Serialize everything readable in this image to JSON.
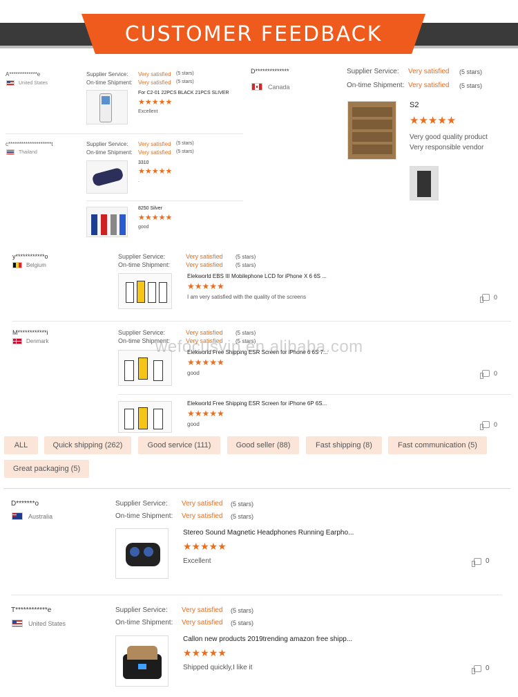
{
  "banner": {
    "title": "CUSTOMER FEEDBACK"
  },
  "labels": {
    "supplier_service": "Supplier Service:",
    "on_time_shipment": "On-time Shipment:",
    "very_satisfied": "Very satisfied",
    "five_stars": "(5 stars)",
    "star_glyph": "★★★★★"
  },
  "collage": {
    "left_reviews": [
      {
        "user": "A*************e",
        "country": "United States",
        "products": [
          {
            "title": "For C2-01 22PCS BLACK 21PCS SLIVER",
            "comment": "Excellent"
          }
        ]
      },
      {
        "user": "c********************t",
        "country": "Thailand",
        "products": [
          {
            "title": "3310",
            "comment": "."
          },
          {
            "title": "8250 Silver",
            "comment": "good"
          }
        ]
      }
    ],
    "right_review": {
      "user": "D**************",
      "country": "Canada",
      "title": "S2",
      "comment_lines": [
        "Very good quality product",
        "Very responsible vendor"
      ]
    },
    "middle_reviews": [
      {
        "user": "y************o",
        "country": "Belgium",
        "products": [
          {
            "title": "Elekworld EBS III Mobilephone LCD for iPhone X 6 6S ...",
            "comment": "I am very satisfied with the quality of the screens",
            "likes": "0"
          }
        ]
      },
      {
        "user": "M************i",
        "country": "Denmark",
        "products": [
          {
            "title": "Elekworld Free Shipping ESR Screen for iPhone 6 6S 7...",
            "comment": "good",
            "likes": "0"
          },
          {
            "title": "Elekworld Free Shipping ESR Screen for iPhone 6P 6S...",
            "comment": "good",
            "likes": "0"
          }
        ]
      }
    ],
    "watermark": "wefocusvip.en.alibaba.com"
  },
  "filters": [
    "ALL",
    "Quick shipping (262)",
    "Good service (111)",
    "Good seller (88)",
    "Fast shipping (8)",
    "Fast communication (5)",
    "Great packaging (5)"
  ],
  "reviews": [
    {
      "user": "D*******o",
      "country": "Australia",
      "title": "Stereo Sound Magnetic Headphones Running Earpho...",
      "comment": "Excellent",
      "likes": "0"
    },
    {
      "user": "T************e",
      "country": "United States",
      "title": "Callon new products 2019trending amazon free shipp...",
      "comment": "Shipped quickly,I like it",
      "likes": "0"
    }
  ],
  "colors": {
    "accent": "#ef6c1a",
    "banner": "#ef5a1d",
    "tag_bg": "#fbe5d8"
  }
}
